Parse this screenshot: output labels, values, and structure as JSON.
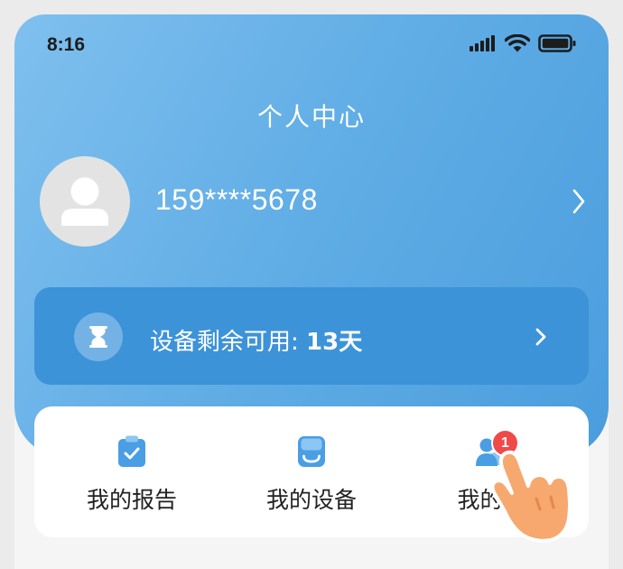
{
  "status_bar": {
    "time": "8:16",
    "icons": [
      "cellular-signal-icon",
      "wifi-icon",
      "battery-icon"
    ]
  },
  "header": {
    "title": "个人中心"
  },
  "profile": {
    "phone": "159****5678",
    "avatar_icon": "user-avatar-icon",
    "arrow_icon": "chevron-right-icon"
  },
  "device_card": {
    "label": "设备剩余可用:",
    "value": "13天",
    "icon": "hourglass-icon",
    "arrow_icon": "chevron-right-icon"
  },
  "menu": {
    "items": [
      {
        "label": "我的报告",
        "icon": "clipboard-check-icon"
      },
      {
        "label": "我的设备",
        "icon": "device-icon"
      },
      {
        "label": "我的亲",
        "icon": "family-icon",
        "badge": "1"
      }
    ]
  },
  "colors": {
    "hero_gradient_start": "#7fc0ee",
    "hero_gradient_end": "#4a9ddd",
    "card_blue": "#3d93d8",
    "badge_red": "#f04a48",
    "hand_skin": "#f7a86e"
  }
}
